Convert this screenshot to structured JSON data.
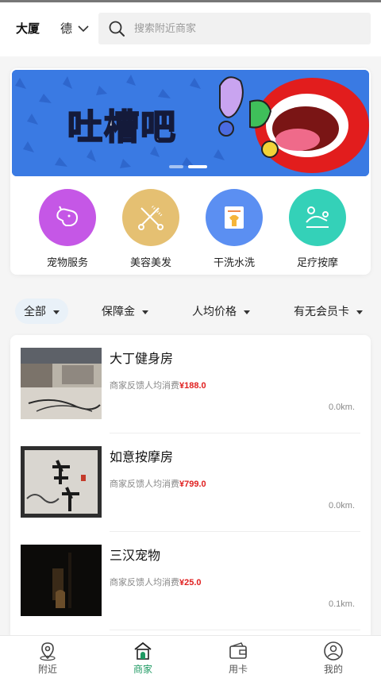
{
  "header": {
    "location": "大厦",
    "district": "德",
    "search_placeholder": "搜索附近商家"
  },
  "banner": {
    "title": "吐槽吧",
    "slide_count": 2,
    "active_slide": 2
  },
  "categories": [
    {
      "label": "宠物服务",
      "icon": "pet-dog-icon",
      "color": "#c557e6"
    },
    {
      "label": "美容美发",
      "icon": "scissors-comb-icon",
      "color": "#e5c072"
    },
    {
      "label": "干洗水洗",
      "icon": "laundry-shirt-icon",
      "color": "#5b8ff2"
    },
    {
      "label": "足疗按摩",
      "icon": "massage-icon",
      "color": "#34d1b8"
    }
  ],
  "filters": [
    {
      "label": "全部",
      "active": true
    },
    {
      "label": "保障金",
      "active": false
    },
    {
      "label": "人均价格",
      "active": false
    },
    {
      "label": "有无会员卡",
      "active": false
    }
  ],
  "list": {
    "sub_prefix": "商家反馈人均消费",
    "items": [
      {
        "name": "大丁健身房",
        "price": "¥188.0",
        "distance": "0.0km."
      },
      {
        "name": "如意按摩房",
        "price": "¥799.0",
        "distance": "0.0km."
      },
      {
        "name": "三汉宠物",
        "price": "¥25.0",
        "distance": "0.1km."
      }
    ]
  },
  "tabbar": {
    "accent": "#1f9a63",
    "tabs": [
      {
        "label": "附近",
        "icon": "location-pin-icon",
        "active": false
      },
      {
        "label": "商家",
        "icon": "store-icon",
        "active": true
      },
      {
        "label": "用卡",
        "icon": "wallet-icon",
        "active": false
      },
      {
        "label": "我的",
        "icon": "user-icon",
        "active": false
      }
    ]
  }
}
